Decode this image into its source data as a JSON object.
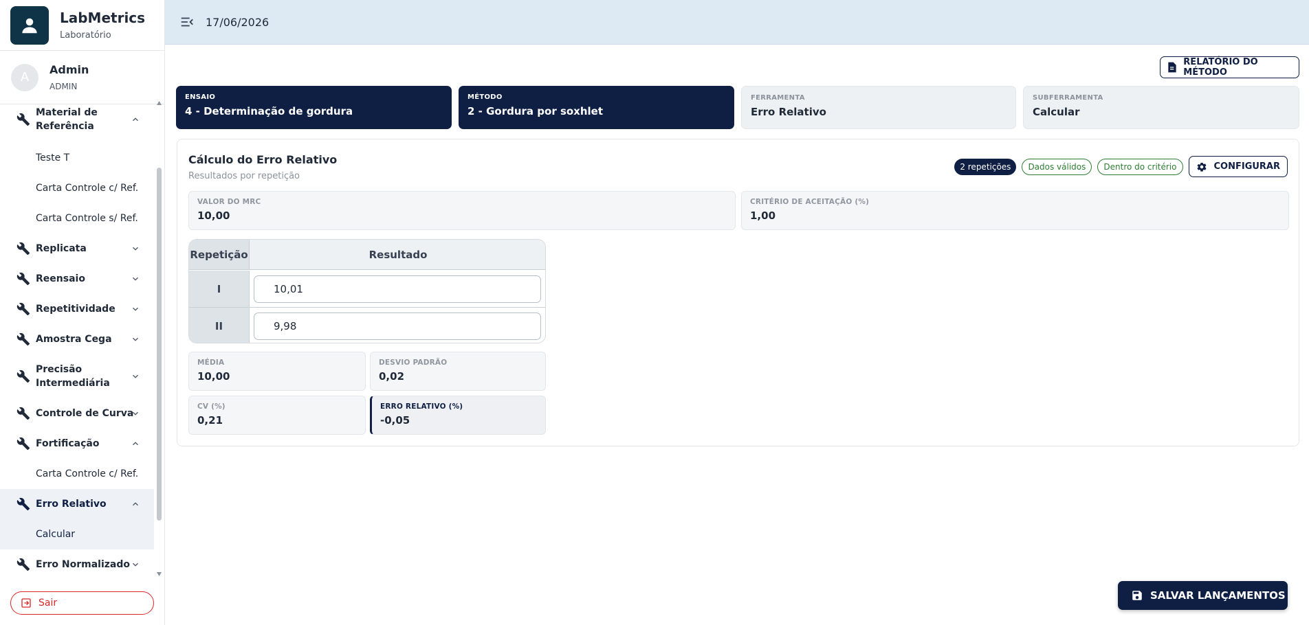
{
  "app": {
    "title": "LabMetrics",
    "subtitle": "Laboratório"
  },
  "user": {
    "initial": "A",
    "name": "Admin",
    "role": "ADMIN"
  },
  "header": {
    "date": "17/06/2026"
  },
  "sidebar": {
    "items": [
      {
        "label": "Material de Referência",
        "expanded": true
      },
      {
        "label": "Teste T"
      },
      {
        "label": "Carta Controle c/ Ref."
      },
      {
        "label": "Carta Controle s/ Ref."
      },
      {
        "label": "Replicata",
        "expanded": false
      },
      {
        "label": "Reensaio",
        "expanded": false
      },
      {
        "label": "Repetitividade",
        "expanded": false
      },
      {
        "label": "Amostra Cega",
        "expanded": false
      },
      {
        "label": "Precisão Intermediária",
        "expanded": false
      },
      {
        "label": "Controle de Curva",
        "expanded": false
      },
      {
        "label": "Fortificação",
        "expanded": true
      },
      {
        "label": "Carta Controle c/ Ref."
      },
      {
        "label": "Erro Relativo",
        "expanded": true,
        "active": true
      },
      {
        "label": "Calcular",
        "active": true
      },
      {
        "label": "Erro Normalizado",
        "expanded": false
      }
    ],
    "logout_label": "Sair"
  },
  "toolbar": {
    "report_label": "RELATÓRIO DO MÉTODO",
    "save_label": "SALVAR LANÇAMENTOS"
  },
  "context": {
    "ensaio": {
      "key": "ENSAIO",
      "value": "4 - Determinação de gordura"
    },
    "metodo": {
      "key": "MÉTODO",
      "value": "2 - Gordura por soxhlet"
    },
    "ferramenta": {
      "key": "FERRAMENTA",
      "value": "Erro Relativo"
    },
    "subferramenta": {
      "key": "SUBFERRAMENTA",
      "value": "Calcular"
    }
  },
  "card": {
    "title": "Cálculo do Erro Relativo",
    "subtitle": "Resultados por repetição",
    "badges": {
      "repeticoes": "2 repetições",
      "dados": "Dados válidos",
      "criterio": "Dentro do critério"
    },
    "config_label": "CONFIGURAR",
    "mrc": {
      "key": "VALOR DO MRC",
      "value": "10,00"
    },
    "criterio": {
      "key": "CRITÉRIO DE ACEITAÇÃO (%)",
      "value": "1,00"
    },
    "table": {
      "headers": [
        "Repetição",
        "Resultado"
      ],
      "rows": [
        {
          "rep": "I",
          "value": "10,01"
        },
        {
          "rep": "II",
          "value": "9,98"
        }
      ]
    },
    "stats": {
      "media": {
        "key": "MÉDIA",
        "value": "10,00"
      },
      "desvio": {
        "key": "DESVIO PADRÃO",
        "value": "0,02"
      },
      "cv": {
        "key": "CV (%)",
        "value": "0,21"
      },
      "erro": {
        "key": "ERRO RELATIVO (%)",
        "value": "-0,05"
      }
    }
  },
  "colors": {
    "primary": "#0f1f44",
    "brand": "#0f3347",
    "topbar": "#dde9f3",
    "success": "#2e7d32",
    "danger": "#dc2626"
  }
}
